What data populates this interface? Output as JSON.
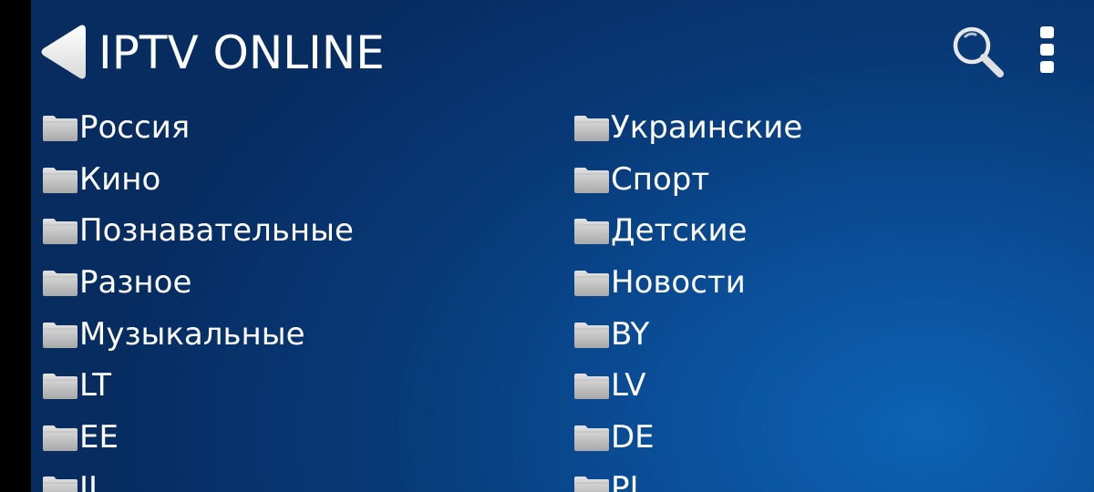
{
  "header": {
    "title": "IPTV ONLINE",
    "back_icon": "back-arrow-icon",
    "search_icon": "search-icon",
    "menu_icon": "more-vertical-icon"
  },
  "colors": {
    "background_dark": "#062c60",
    "background_light": "#0d63b4",
    "text": "#ffffff",
    "folder": "#c8c8c8"
  },
  "categories": {
    "left": [
      {
        "label": "Россия",
        "icon": "folder-icon"
      },
      {
        "label": "Кино",
        "icon": "folder-icon"
      },
      {
        "label": "Познавательные",
        "icon": "folder-icon"
      },
      {
        "label": "Разное",
        "icon": "folder-icon"
      },
      {
        "label": "Музыкальные",
        "icon": "folder-icon"
      },
      {
        "label": "LT",
        "icon": "folder-icon"
      },
      {
        "label": "EE",
        "icon": "folder-icon"
      },
      {
        "label": "IL",
        "icon": "folder-icon"
      }
    ],
    "right": [
      {
        "label": "Украинские",
        "icon": "folder-icon"
      },
      {
        "label": "Спорт",
        "icon": "folder-icon"
      },
      {
        "label": "Детские",
        "icon": "folder-icon"
      },
      {
        "label": "Новости",
        "icon": "folder-icon"
      },
      {
        "label": "BY",
        "icon": "folder-icon"
      },
      {
        "label": "LV",
        "icon": "folder-icon"
      },
      {
        "label": "DE",
        "icon": "folder-icon"
      },
      {
        "label": "PL",
        "icon": "folder-icon"
      }
    ]
  }
}
